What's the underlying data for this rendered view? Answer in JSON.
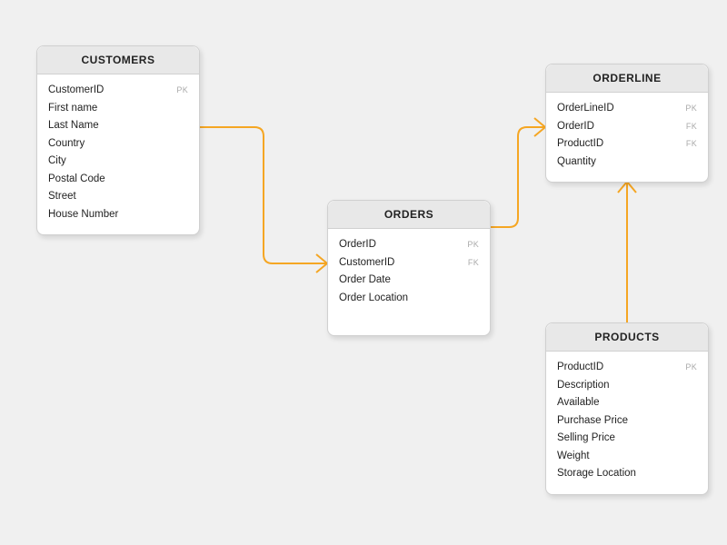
{
  "entities": {
    "customers": {
      "title": "CUSTOMERS",
      "fields": [
        {
          "name": "CustomerID",
          "key": "PK"
        },
        {
          "name": "First name",
          "key": ""
        },
        {
          "name": "Last Name",
          "key": ""
        },
        {
          "name": "Country",
          "key": ""
        },
        {
          "name": "City",
          "key": ""
        },
        {
          "name": "Postal Code",
          "key": ""
        },
        {
          "name": "Street",
          "key": ""
        },
        {
          "name": "House Number",
          "key": ""
        }
      ]
    },
    "orders": {
      "title": "ORDERS",
      "fields": [
        {
          "name": "OrderID",
          "key": "PK"
        },
        {
          "name": "CustomerID",
          "key": "FK"
        },
        {
          "name": "Order Date",
          "key": ""
        },
        {
          "name": "Order Location",
          "key": ""
        }
      ]
    },
    "orderline": {
      "title": "ORDERLINE",
      "fields": [
        {
          "name": "OrderLineID",
          "key": "PK"
        },
        {
          "name": "OrderID",
          "key": "FK"
        },
        {
          "name": "ProductID",
          "key": "FK"
        },
        {
          "name": "Quantity",
          "key": ""
        }
      ]
    },
    "products": {
      "title": "PRODUCTS",
      "fields": [
        {
          "name": "ProductID",
          "key": "PK"
        },
        {
          "name": "Description",
          "key": ""
        },
        {
          "name": "Available",
          "key": ""
        },
        {
          "name": "Purchase Price",
          "key": ""
        },
        {
          "name": "Selling Price",
          "key": ""
        },
        {
          "name": "Weight",
          "key": ""
        },
        {
          "name": "Storage Location",
          "key": ""
        }
      ]
    }
  },
  "relationships": [
    {
      "from": "customers",
      "to": "orders",
      "type": "one-to-many"
    },
    {
      "from": "orders",
      "to": "orderline",
      "type": "one-to-many"
    },
    {
      "from": "products",
      "to": "orderline",
      "type": "one-to-many"
    }
  ],
  "colors": {
    "connector": "#f5a623"
  }
}
